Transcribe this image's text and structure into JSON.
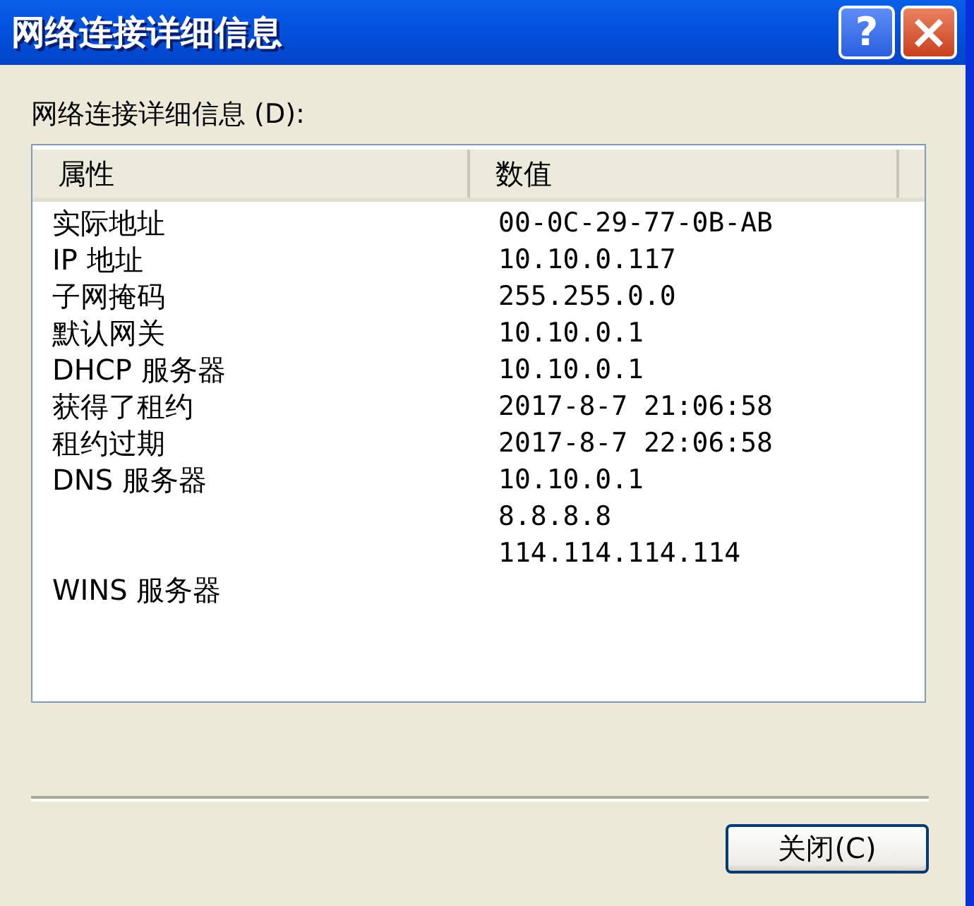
{
  "window": {
    "title": "网络连接详细信息"
  },
  "title_buttons": [
    {
      "kind": "help",
      "label": "?"
    },
    {
      "kind": "close",
      "label": "×"
    }
  ],
  "list_label": "网络连接详细信息 (D):",
  "table": {
    "columns": [
      "属性",
      "数值"
    ],
    "rows": [
      {
        "property": "实际地址",
        "value": "00-0C-29-77-0B-AB"
      },
      {
        "property": "IP 地址",
        "value": "10.10.0.117"
      },
      {
        "property": "子网掩码",
        "value": "255.255.0.0"
      },
      {
        "property": "默认网关",
        "value": "10.10.0.1"
      },
      {
        "property": "DHCP 服务器",
        "value": "10.10.0.1"
      },
      {
        "property": "获得了租约",
        "value": "2017-8-7 21:06:58"
      },
      {
        "property": "租约过期",
        "value": "2017-8-7 22:06:58"
      },
      {
        "property": "DNS 服务器",
        "value": "10.10.0.1"
      },
      {
        "value": "8.8.8.8"
      },
      {
        "value": "114.114.114.114"
      },
      {
        "property": "WINS 服务器"
      }
    ]
  },
  "buttons": [
    "关闭(C)"
  ]
}
